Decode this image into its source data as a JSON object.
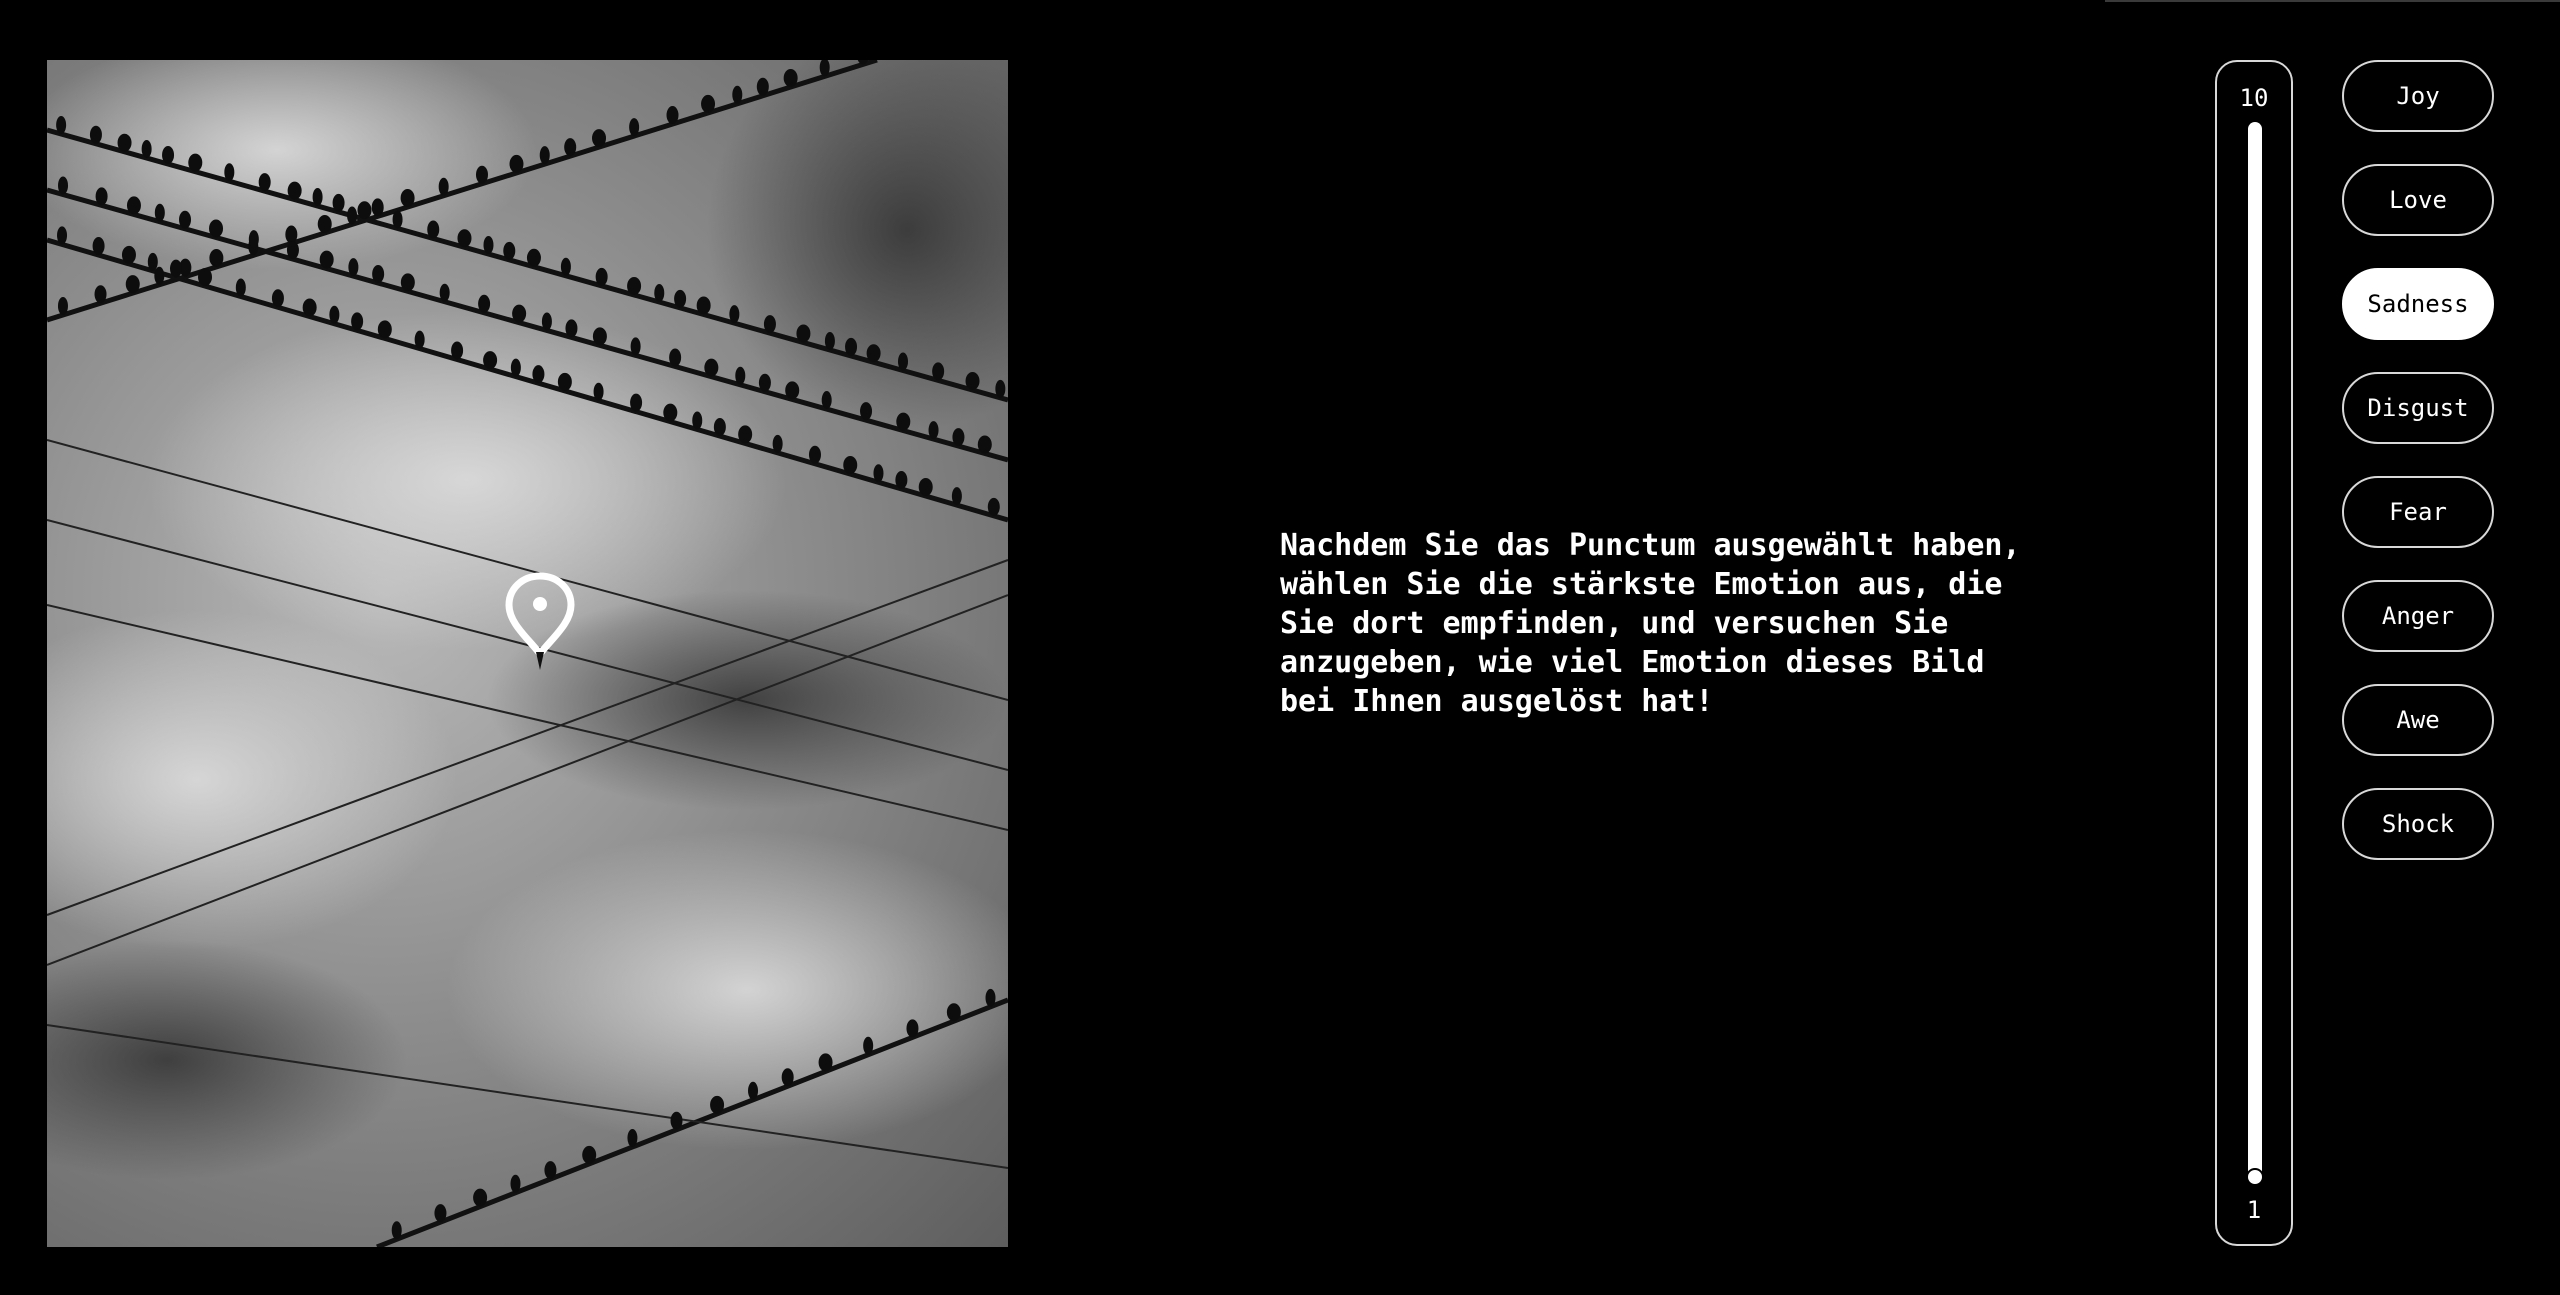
{
  "instruction": "Nachdem Sie das Punctum ausgewählt haben,\nwählen Sie die stärkste Emotion aus, die\nSie dort empfinden, und versuchen Sie\nanzugeben, wie viel Emotion dieses Bild\nbei Ihnen ausgelöst hat!",
  "intensity": {
    "max_label": "10",
    "min_label": "1",
    "value": 1
  },
  "emotions": [
    {
      "label": "Joy",
      "selected": false
    },
    {
      "label": "Love",
      "selected": false
    },
    {
      "label": "Sadness",
      "selected": true
    },
    {
      "label": "Disgust",
      "selected": false
    },
    {
      "label": "Fear",
      "selected": false
    },
    {
      "label": "Anger",
      "selected": false
    },
    {
      "label": "Awe",
      "selected": false
    },
    {
      "label": "Shock",
      "selected": false
    }
  ]
}
